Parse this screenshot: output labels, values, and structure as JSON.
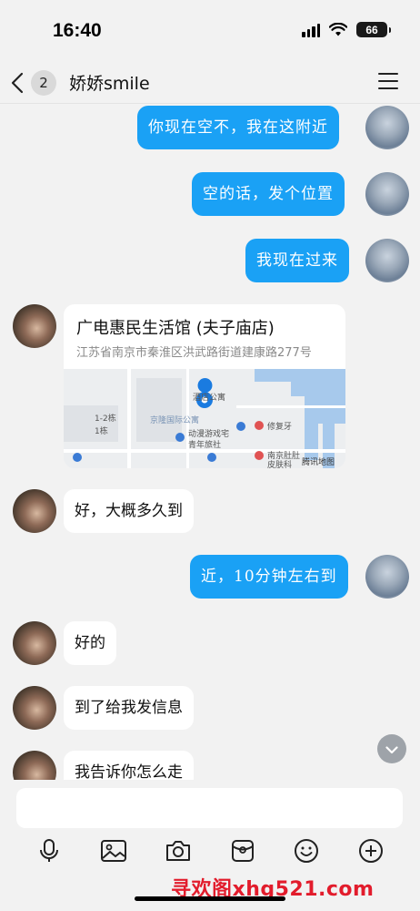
{
  "status_bar": {
    "time": "16:40",
    "battery": "66"
  },
  "header": {
    "back_badge": "2",
    "title": "娇娇smile"
  },
  "messages": [
    {
      "side": "out",
      "text": "你现在空不，我在这附近"
    },
    {
      "side": "out",
      "text": "空的话，发个位置"
    },
    {
      "side": "out",
      "text": "我现在过来"
    },
    {
      "side": "in",
      "type": "location",
      "name": "广电惠民生活馆 (夫子庙店)",
      "address": "江苏省南京市秦淮区洪武路街道建康路277号"
    },
    {
      "side": "in",
      "text": "好，大概多久到"
    },
    {
      "side": "out",
      "text": "近，10分钟左右到"
    },
    {
      "side": "in",
      "text": "好的"
    },
    {
      "side": "in",
      "text": "到了给我发信息"
    },
    {
      "side": "in",
      "text": "我告诉你怎么走"
    }
  ],
  "map_labels": {
    "hotel": "酒店公寓",
    "plaza": "京隆国际公寓",
    "building": "1-2栋",
    "building2": "1栋",
    "hostel1": "动漫游戏宅",
    "hostel2": "青年旅社",
    "repair": "修复牙",
    "clinic1": "南京肚肚",
    "clinic2": "皮肤科",
    "provider": "腾讯地图"
  },
  "input": {
    "placeholder": ""
  },
  "toolbar": [
    "microphone-icon",
    "image-icon",
    "camera-icon",
    "red-packet-icon",
    "emoji-icon",
    "plus-icon"
  ],
  "watermark": "寻欢阁xhg521.com",
  "colors": {
    "outgoing_bubble": "#1aa1f5",
    "incoming_bubble": "#ffffff",
    "background": "#f2f2f2",
    "watermark": "#e21c2c"
  }
}
